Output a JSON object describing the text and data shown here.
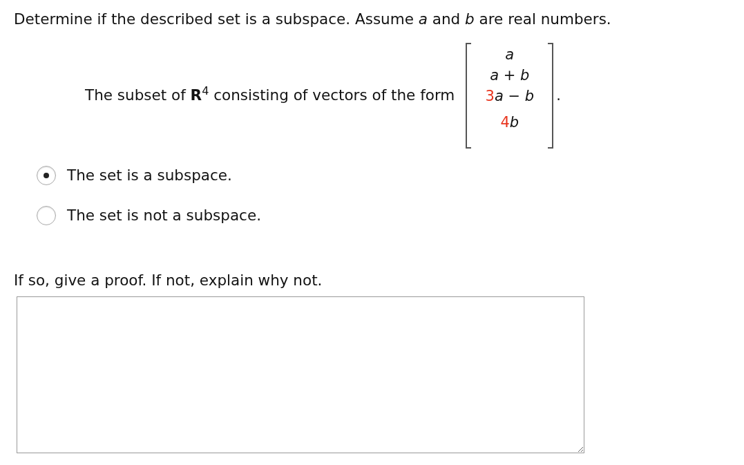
{
  "question": "Determine if the described set is a subspace. Assume *a* and *b* are real numbers.",
  "subset_text": "The subset of **R**$^{4}$ consisting of vectors of the form",
  "vector": [
    {
      "expression": "*a*"
    },
    {
      "expression": "*a* + *b*"
    },
    {
      "coefficient": "3",
      "expression": "*a* − *b*"
    },
    {
      "coefficient": "4",
      "expression": "*b*"
    }
  ],
  "vector_end": ".",
  "options": [
    {
      "label": "The set is a subspace.",
      "selected": true
    },
    {
      "label": "The set is not a subspace.",
      "selected": false
    }
  ],
  "proof_prompt": "If so, give a proof. If not, explain why not."
}
